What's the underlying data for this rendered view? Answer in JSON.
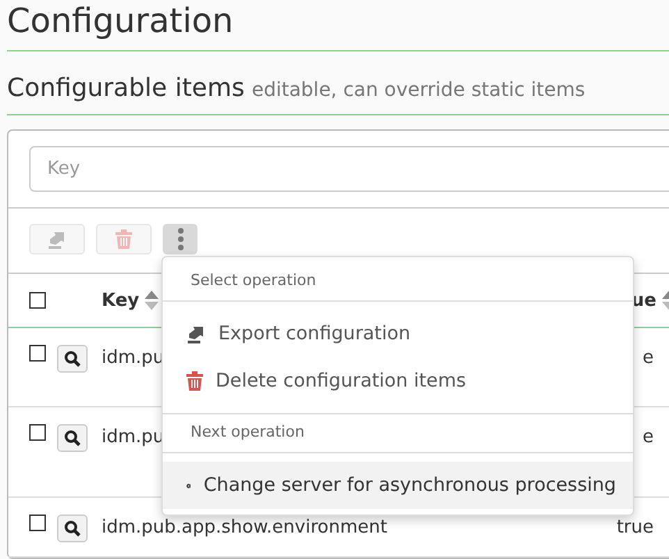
{
  "page_title": "Configuration",
  "section": {
    "title": "Configurable items",
    "subtitle": "editable, can override static items"
  },
  "search": {
    "placeholder": "Key"
  },
  "toolbar": [
    {
      "kind": "export",
      "disabled": true
    },
    {
      "kind": "delete",
      "disabled": true
    },
    {
      "kind": "more",
      "disabled": false
    }
  ],
  "table": {
    "all_selected": false,
    "columns": [
      {
        "label": "Key"
      },
      {
        "label": "ue"
      }
    ],
    "rows": [
      {
        "selected": false,
        "key": "idm.pu",
        "value": "e"
      },
      {
        "selected": false,
        "key": "idm.pu",
        "value": "e"
      },
      {
        "selected": false,
        "key": "idm.pub.app.show.environment",
        "value": "true"
      }
    ]
  },
  "menu": [
    {
      "kind": "header",
      "label": "Select operation"
    },
    {
      "kind": "export",
      "label": "Export configuration",
      "highlighted": false
    },
    {
      "kind": "delete",
      "label": "Delete configuration items",
      "highlighted": false
    },
    {
      "kind": "header",
      "label": "Next operation"
    },
    {
      "kind": "gear",
      "label": "Change server for asynchronous processing",
      "highlighted": true
    }
  ]
}
